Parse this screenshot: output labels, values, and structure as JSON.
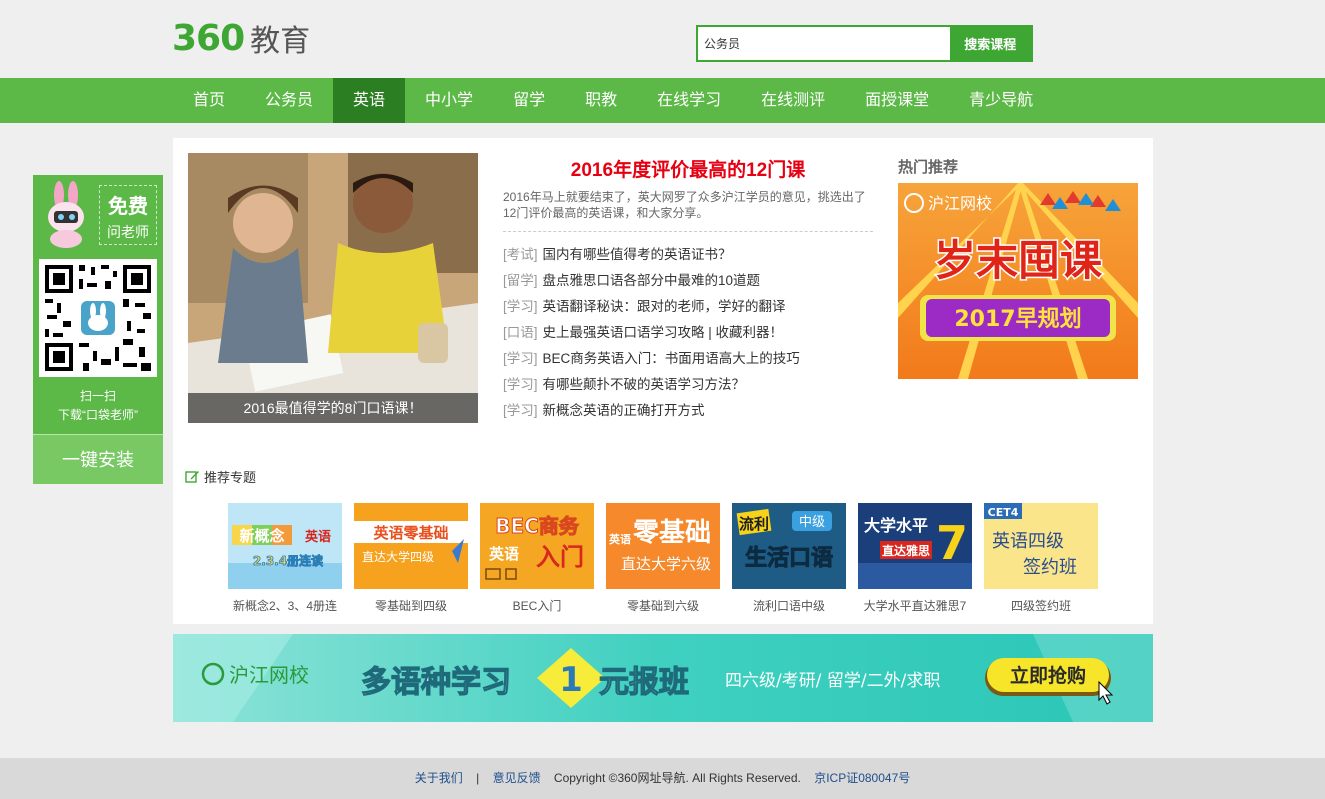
{
  "header": {
    "logo_num": "360",
    "logo_text": "教育",
    "search_value": "公务员",
    "search_button": "搜索课程"
  },
  "nav": {
    "items": [
      "首页",
      "公务员",
      "英语",
      "中小学",
      "留学",
      "职教",
      "在线学习",
      "在线测评",
      "面授课堂",
      "青少导航"
    ],
    "active_index": 2
  },
  "float": {
    "free_title": "免费",
    "free_sub": "问老师",
    "scan": "扫一扫",
    "download": "下载“口袋老师”",
    "install": "一键安装"
  },
  "hero": {
    "caption": "2016最值得学的8门口语课！"
  },
  "feature": {
    "title": "2016年度评价最高的12门课",
    "desc": "2016年马上就要结束了，英大网罗了众多沪江学员的意见，挑选出了12门评价最高的英语课，和大家分享。",
    "articles": [
      {
        "tag": "[考试]",
        "title": "国内有哪些值得考的英语证书？"
      },
      {
        "tag": "[留学]",
        "title": "盘点雅思口语各部分中最难的10道题"
      },
      {
        "tag": "[学习]",
        "title": "英语翻译秘诀：跟对的老师，学好的翻译"
      },
      {
        "tag": "[口语]",
        "title": "史上最强英语口语学习攻略 | 收藏利器！"
      },
      {
        "tag": "[学习]",
        "title": "BEC商务英语入门：书面用语高大上的技巧"
      },
      {
        "tag": "[学习]",
        "title": "有哪些颠扑不破的英语学习方法？"
      },
      {
        "tag": "[学习]",
        "title": "新概念英语的正确打开方式"
      }
    ]
  },
  "hot": {
    "title": "热门推荐",
    "ad_brand": "沪江网校",
    "ad_main": "岁末囤课",
    "ad_sub": "2017早规划"
  },
  "topics": {
    "head": "推荐专题",
    "items": [
      {
        "caption": "新概念2、3、4册连",
        "pic_line1": "新概念",
        "pic_line2": "英语",
        "pic_line3": "2.3.4册连读"
      },
      {
        "caption": "零基础到四级",
        "pic_line1": "英语零基础",
        "pic_line2": "直达大学四级",
        "pic_line3": ""
      },
      {
        "caption": "BEC入门",
        "pic_line1": "BEC商务",
        "pic_line2": "英语",
        "pic_line3": "入门"
      },
      {
        "caption": "零基础到六级",
        "pic_line1": "英语",
        "pic_line2": "零基础",
        "pic_line3": "直达大学六级"
      },
      {
        "caption": "流利口语中级",
        "pic_line1": "流利",
        "pic_line2": "中级",
        "pic_line3": "生活口语"
      },
      {
        "caption": "大学水平直达雅思7",
        "pic_line1": "大学水平",
        "pic_line2": "直达雅思",
        "pic_line3": "7"
      },
      {
        "caption": "四级签约班",
        "pic_line1": "CET4",
        "pic_line2": "英语四级",
        "pic_line3": "签约班"
      }
    ]
  },
  "banner": {
    "brand": "沪江网校",
    "text_a": "多语种学习",
    "text_num": "1",
    "text_b": "元报班",
    "langs": "四六级/考研/ 留学/二外/求职",
    "cta": "立即抢购"
  },
  "footer": {
    "about": "关于我们",
    "divider": "|",
    "feedback": "意见反馈",
    "copyright": "Copyright ©360网址导航.   All Rights Reserved.",
    "icp": "京ICP证080047号"
  },
  "colors": {
    "brand_green": "#3ea733",
    "nav_green": "#5cb947",
    "nav_active": "#2c7e22",
    "headline_red": "#e60012"
  }
}
